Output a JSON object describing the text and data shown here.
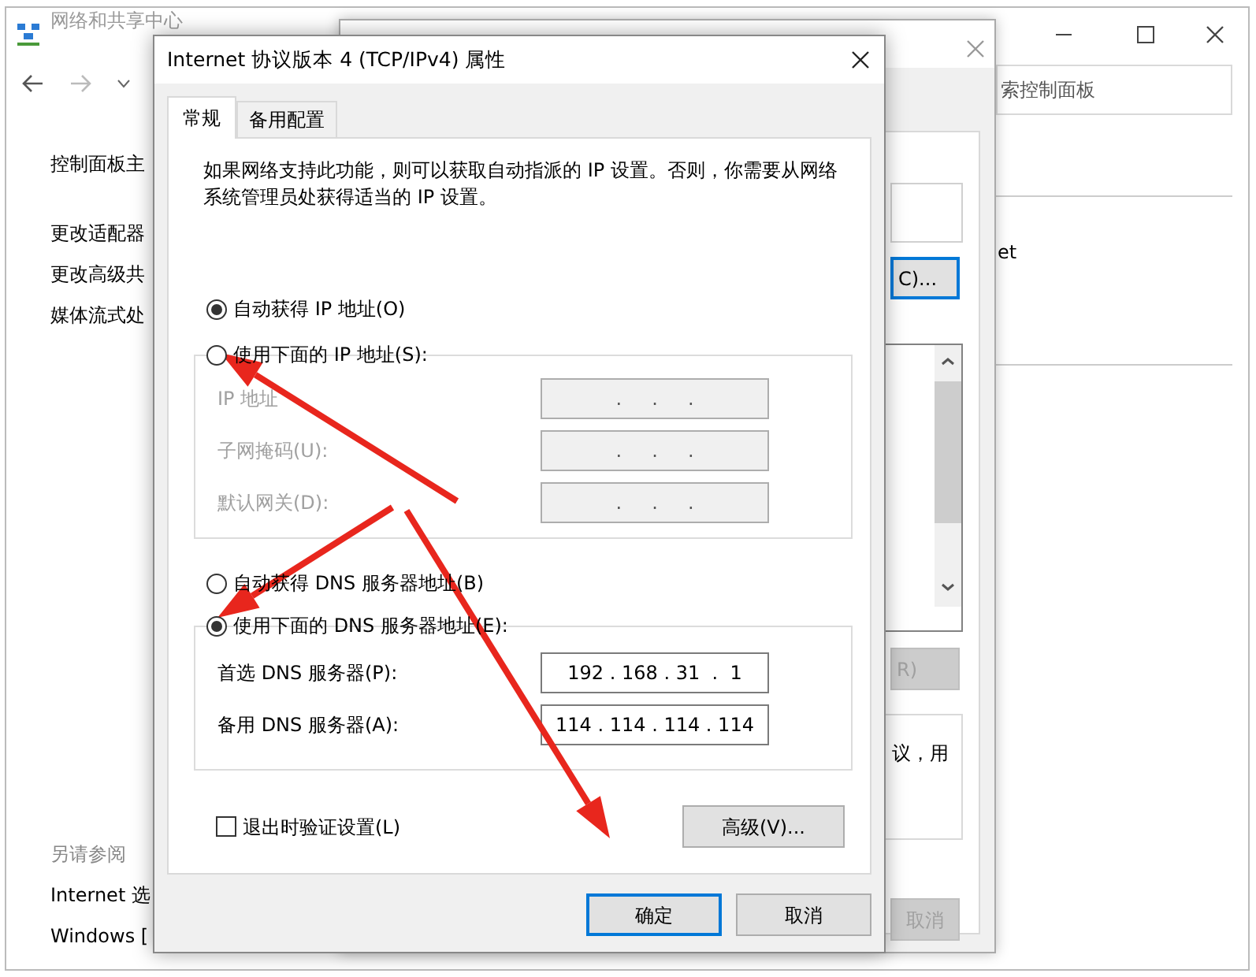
{
  "network_window": {
    "title": "网络和共享中心",
    "search": {
      "placeholder": "索控制面板"
    },
    "sidebar": {
      "items": [
        {
          "label": "控制面板主"
        },
        {
          "label": "更改适配器"
        },
        {
          "label": "更改高级共"
        },
        {
          "label": "媒体流式处"
        }
      ],
      "see_also_title": "另请参阅",
      "see_also": [
        {
          "label": "Internet 选"
        },
        {
          "label": "Windows ["
        }
      ]
    },
    "content_text": "et"
  },
  "ethernet_window": {
    "buttons": [
      {
        "kind": "configure",
        "label": "C)...",
        "default": true,
        "disabled": false
      },
      {
        "kind": "properties",
        "label": "R)",
        "default": false,
        "disabled": true
      }
    ],
    "description": "议，用",
    "cancel_button": {
      "label": "取消",
      "disabled": true
    }
  },
  "dialog": {
    "title": "Internet 协议版本 4 (TCP/IPv4) 属性",
    "tabs": [
      {
        "label": "常规",
        "selected": true
      },
      {
        "label": "备用配置",
        "selected": false
      }
    ],
    "description": "如果网络支持此功能，则可以获取自动指派的 IP 设置。否则，你需要从网络系统管理员处获得适当的 IP 设置。",
    "ip_mode": [
      {
        "label": "自动获得 IP 地址(O)",
        "selected": true
      },
      {
        "label": "使用下面的 IP 地址(S):",
        "selected": false
      }
    ],
    "ip_fields": {
      "disabled": true,
      "rows": [
        {
          "label": "IP 地址",
          "value": ".     .     ."
        },
        {
          "label": "子网掩码(U):",
          "value": ".     .     ."
        },
        {
          "label": "默认网关(D):",
          "value": ".     .     ."
        }
      ]
    },
    "dns_mode": [
      {
        "label": "自动获得 DNS 服务器地址(B)",
        "selected": false
      },
      {
        "label": "使用下面的 DNS 服务器地址(E):",
        "selected": true
      }
    ],
    "dns_fields": {
      "disabled": false,
      "rows": [
        {
          "label": "首选 DNS 服务器(P):",
          "value": "192 . 168 . 31  .  1"
        },
        {
          "label": "备用 DNS 服务器(A):",
          "value": "114 . 114 . 114 . 114"
        }
      ]
    },
    "verify_on_exit": {
      "label": "退出时验证设置(L)",
      "checked": false
    },
    "advanced_button": "高级(V)...",
    "buttons": [
      {
        "label": "确定",
        "default": true
      },
      {
        "label": "取消",
        "default": false
      }
    ]
  }
}
